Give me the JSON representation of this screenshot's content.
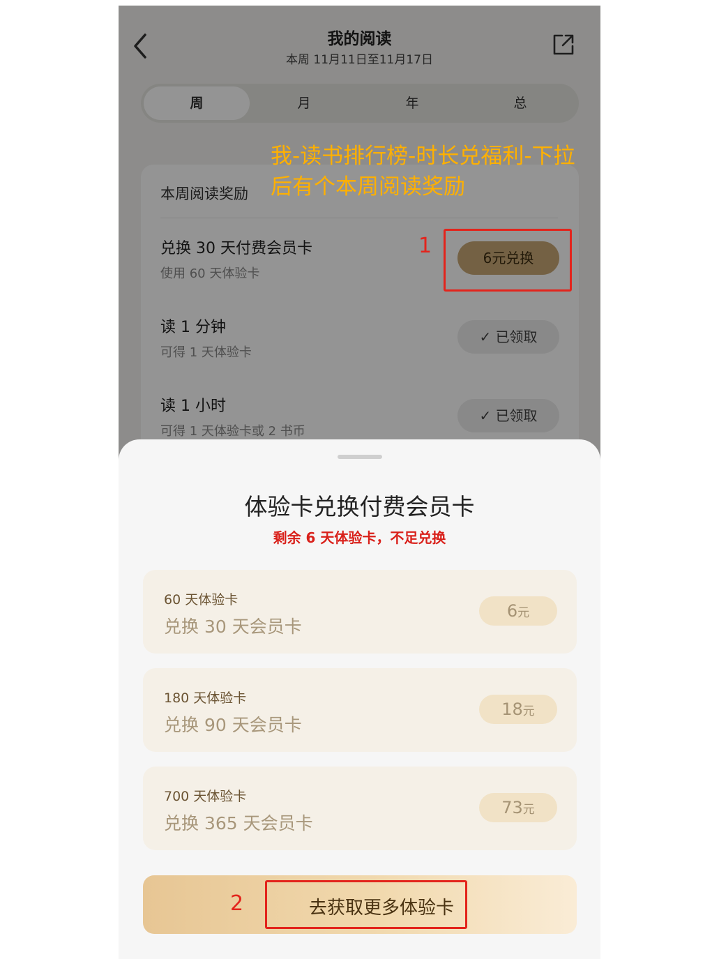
{
  "header": {
    "title": "我的阅读",
    "subtitle": "本周 11月11日至11月17日"
  },
  "tabs": [
    {
      "label": "周"
    },
    {
      "label": "月"
    },
    {
      "label": "年"
    },
    {
      "label": "总"
    }
  ],
  "section": {
    "title": "本周阅读奖励"
  },
  "rewards": [
    {
      "title": "兑换 30 天付费会员卡",
      "sub": "使用 60 天体验卡",
      "button": "6元兑换"
    },
    {
      "title": "读 1 分钟",
      "sub": "可得 1 天体验卡",
      "button": "已领取",
      "check": "✓"
    },
    {
      "title": "读 1 小时",
      "sub": "可得 1 天体验卡或 2 书币",
      "button": "已领取",
      "check": "✓"
    }
  ],
  "annotation": {
    "line1": "我-读书排行榜-时长兑福利-下拉",
    "line2": "后有个本周阅读奖励",
    "num1": "1",
    "num2": "2"
  },
  "sheet": {
    "title": "体验卡兑换付费会员卡",
    "note": "剩余 6 天体验卡，不足兑换",
    "options": [
      {
        "card": "60 天体验卡",
        "exchange": "兑换 30 天会员卡",
        "price": "6",
        "unit": "元"
      },
      {
        "card": "180 天体验卡",
        "exchange": "兑换 90 天会员卡",
        "price": "18",
        "unit": "元"
      },
      {
        "card": "700 天体验卡",
        "exchange": "兑换 365 天会员卡",
        "price": "73",
        "unit": "元"
      }
    ],
    "cta": "去获取更多体验卡"
  },
  "colors": {
    "accent": "#c8a876",
    "annotation": "#ffb000",
    "highlight": "#e3241c"
  },
  "icons": {
    "back": "back-chevron-icon",
    "share": "share-external-icon",
    "check": "check-icon"
  }
}
